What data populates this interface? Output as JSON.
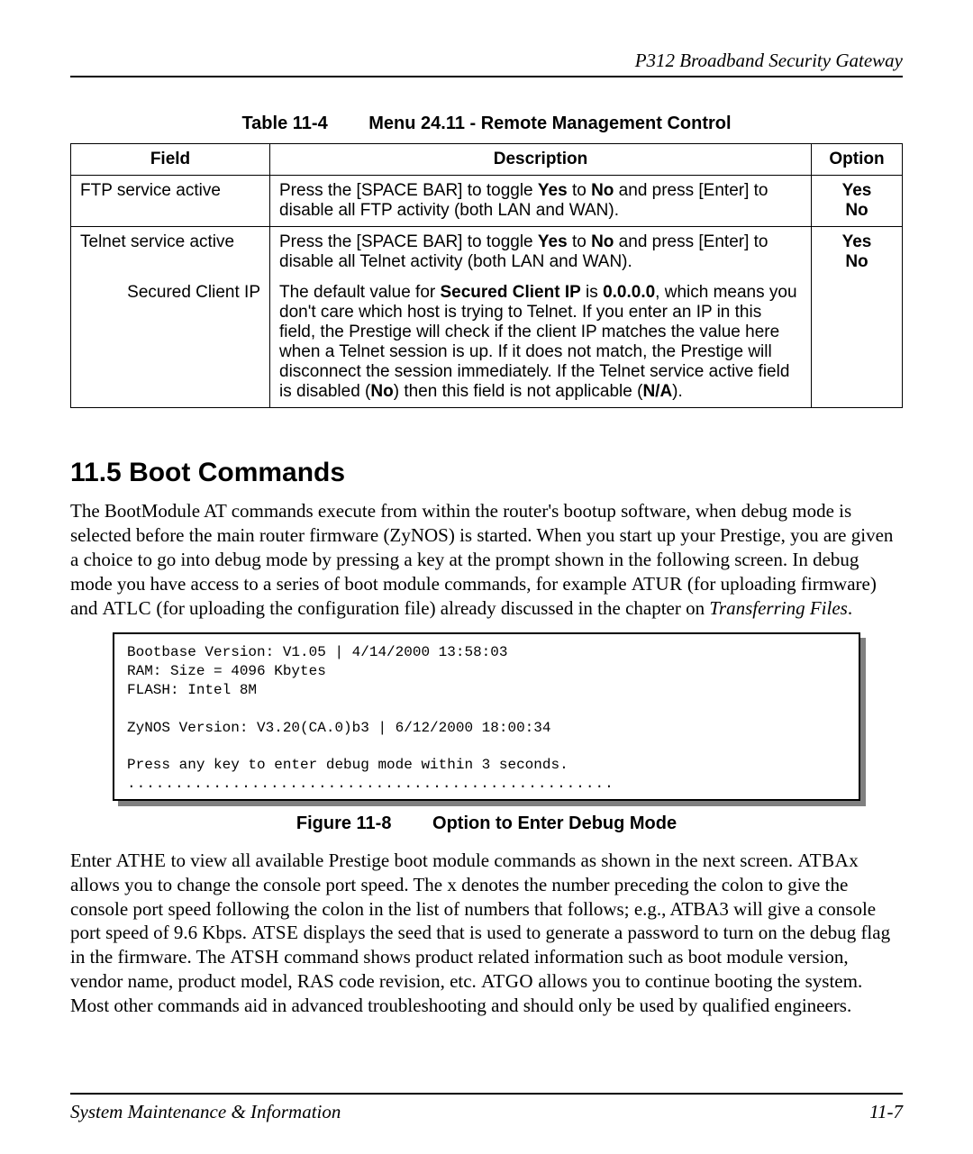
{
  "header": {
    "product": "P312  Broadband Security Gateway"
  },
  "table_caption": {
    "label": "Table 11-4",
    "title": "Menu 24.11 - Remote Management Control"
  },
  "table": {
    "headers": {
      "field": "Field",
      "desc": "Description",
      "opt": "Option"
    },
    "rows": [
      {
        "field": "FTP service active",
        "desc_pre": "Press the [SPACE BAR] to toggle ",
        "desc_b1": "Yes",
        "desc_mid": " to ",
        "desc_b2": "No",
        "desc_post": " and press [Enter] to disable all FTP activity (both LAN and WAN).",
        "opt1": "Yes",
        "opt2": "No"
      },
      {
        "field": "Telnet service active",
        "desc_pre": "Press the [SPACE BAR] to toggle ",
        "desc_b1": "Yes",
        "desc_mid": " to ",
        "desc_b2": "No",
        "desc_post": " and press [Enter] to disable all Telnet activity (both LAN and WAN).",
        "opt1": "Yes",
        "opt2": "No"
      },
      {
        "field": "Secured Client IP",
        "d1": "The default value for ",
        "d2": "Secured Client IP",
        "d3": " is ",
        "d4": "0.0.0.0",
        "d5": ", which means you don't care which host is trying to Telnet. If you enter an IP in this field, the Prestige will check if the client IP matches the value here when a Telnet session is up. If it does not match, the Prestige will disconnect the session immediately.  If the Telnet service active field is disabled (",
        "d6": "No",
        "d7": ") then this field is not applicable (",
        "d8": "N/A",
        "d9": ")."
      }
    ]
  },
  "section": {
    "heading": "11.5  Boot Commands",
    "p1a": "The BootModule AT commands execute from within the router's bootup software, when debug mode is selected before the main router firmware (ZyNOS) is started. When you start up your Prestige, you are given a choice to go into debug mode by pressing a key at the prompt shown in the following screen. In debug mode you have access to a series of boot module commands, for example ",
    "p1_cmd1": "ATUR",
    "p1b": " (for uploading firmware) and ",
    "p1_cmd2": "ATLC",
    "p1c": " (for uploading the configuration file) already discussed in the chapter on ",
    "p1_ref": "Transferring Files",
    "p1d": "."
  },
  "code": {
    "l1": "Bootbase Version: V1.05 | 4/14/2000 13:58:03",
    "l2": "RAM: Size = 4096 Kbytes",
    "l3": "FLASH: Intel 8M",
    "l4": "",
    "l5": "ZyNOS Version: V3.20(CA.0)b3 | 6/12/2000 18:00:34",
    "l6": "",
    "l7": "Press any key to enter debug mode within 3 seconds.",
    "l8": "..................................................."
  },
  "figure_caption": {
    "label": "Figure 11-8",
    "title": "Option to Enter Debug Mode"
  },
  "para2": {
    "a": "Enter ",
    "cmd1": "ATHE",
    "b": " to view all available Prestige boot module commands as shown in the next screen. ",
    "cmd2": "ATBAx",
    "c": " allows you to change the console port speed. The x denotes the number preceding the colon to give the console port speed following the colon in the list of numbers that follows; e.g., ATBA3 will give a console port speed of 9.6 Kbps.  ",
    "cmd3": "ATSE",
    "d": " displays the seed that is used to generate a password to turn on the debug flag in the firmware. The ",
    "cmd4": "ATSH",
    "e": " command shows product related information such as boot module version, vendor name, product model, RAS code revision, etc. ",
    "cmd5": "ATGO",
    "f": " allows you to continue booting the system. Most other commands aid in advanced troubleshooting and should only be used by qualified engineers."
  },
  "footer": {
    "left": "System Maintenance & Information",
    "right": "11-7"
  }
}
